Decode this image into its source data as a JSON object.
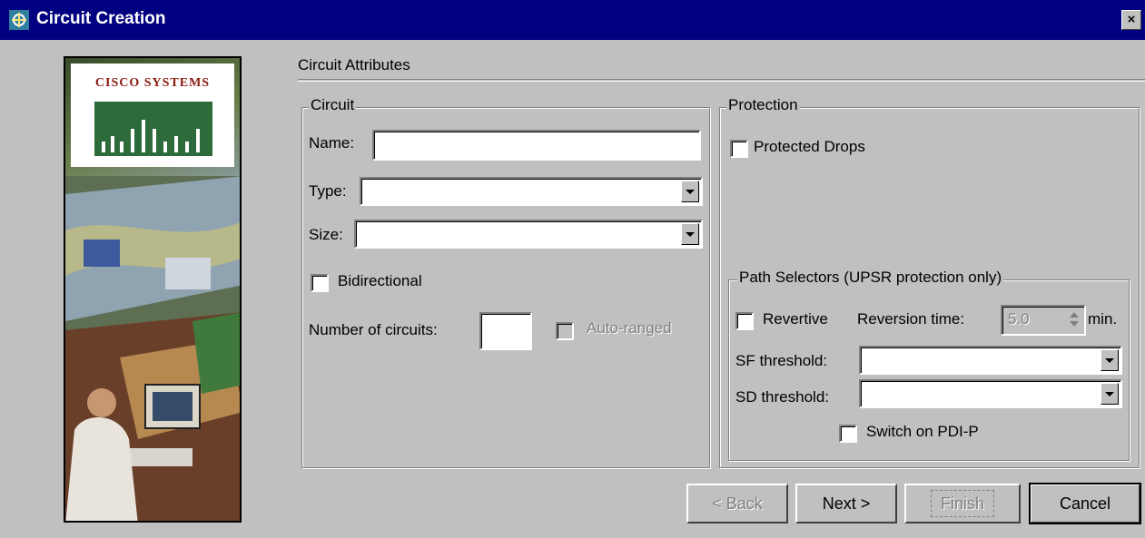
{
  "window": {
    "title": "Circuit Creation",
    "close_glyph": "×"
  },
  "brand": {
    "name": "CISCO SYSTEMS"
  },
  "section": {
    "title": "Circuit Attributes"
  },
  "circuit": {
    "legend": "Circuit",
    "name_label": "Name:",
    "name_value": "",
    "type_label": "Type:",
    "type_value": "",
    "size_label": "Size:",
    "size_value": "",
    "bidirectional_label": "Bidirectional",
    "bidirectional_checked": false,
    "num_circuits_label": "Number of circuits:",
    "num_circuits_value": "",
    "auto_ranged_label": "Auto-ranged",
    "auto_ranged_enabled": false
  },
  "protection": {
    "legend": "Protection",
    "protected_drops_label": "Protected Drops",
    "protected_drops_checked": false,
    "path_selectors": {
      "legend": "Path Selectors (UPSR protection only)",
      "revertive_label": "Revertive",
      "reversion_time_label": "Reversion time:",
      "reversion_time_value": "5.0",
      "reversion_unit": "min.",
      "sf_threshold_label": "SF threshold:",
      "sf_threshold_value": "",
      "sd_threshold_label": "SD threshold:",
      "sd_threshold_value": "",
      "switch_pdi_label": "Switch on PDI-P"
    }
  },
  "buttons": {
    "back": "< Back",
    "next": "Next >",
    "finish": "Finish",
    "cancel": "Cancel"
  },
  "icons": {
    "app": "circuit-app-icon",
    "close": "close-icon",
    "dropdown": "chevron-down-icon",
    "spinner": "spinner-arrows-icon"
  },
  "colors": {
    "titlebar": "#000080",
    "face": "#c0c0c0",
    "brand_red": "#8a1a10",
    "brand_green": "#2e6b3a"
  }
}
